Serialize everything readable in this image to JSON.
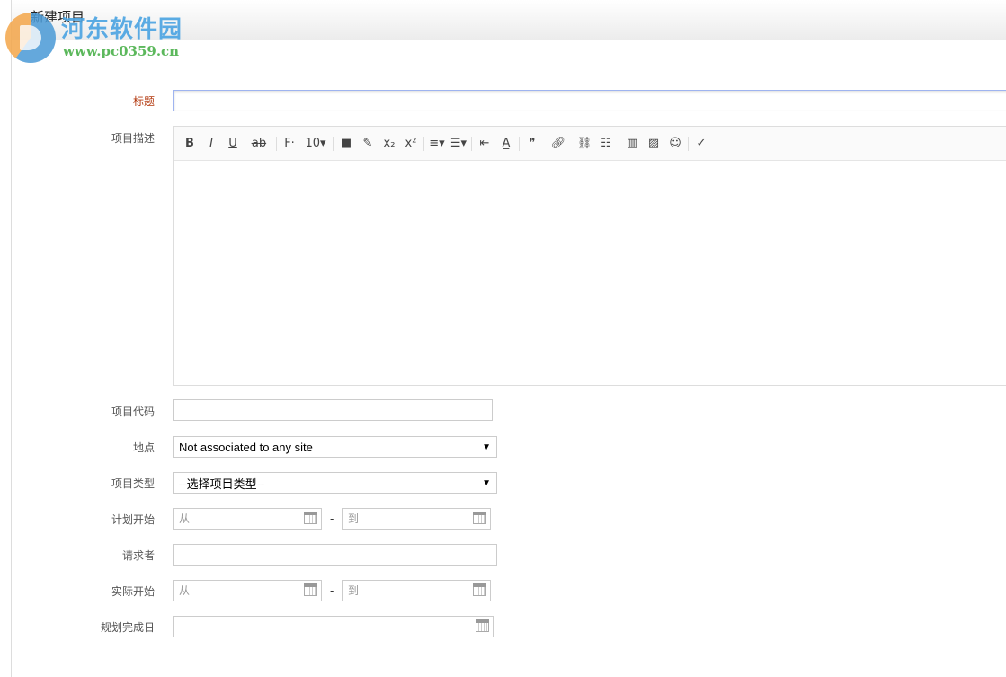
{
  "header": {
    "title": "新建项目"
  },
  "logo": {
    "name": "河东软件园",
    "url": "www.pc0359.cn"
  },
  "form": {
    "title": {
      "label": "标题",
      "value": ""
    },
    "description": {
      "label": "项目描述"
    },
    "code": {
      "label": "项目代码",
      "value": ""
    },
    "site": {
      "label": "地点",
      "selected": "Not associated to any site"
    },
    "type": {
      "label": "项目类型",
      "selected": "--选择项目类型--"
    },
    "planned_start": {
      "label": "计划开始",
      "from_placeholder": "从",
      "to_placeholder": "到",
      "separator": "-"
    },
    "requester": {
      "label": "请求者",
      "value": ""
    },
    "actual_start": {
      "label": "实际开始",
      "from_placeholder": "从",
      "to_placeholder": "到",
      "separator": "-"
    },
    "planned_end": {
      "label": "规划完成日",
      "value": ""
    }
  },
  "toolbar": {
    "items": [
      {
        "icon": "bold-icon",
        "glyph": "B"
      },
      {
        "icon": "italic-icon",
        "glyph": "I"
      },
      {
        "icon": "underline-icon",
        "glyph": "U"
      },
      {
        "icon": "strikethrough-icon",
        "glyph": "a̶b̶"
      },
      {
        "icon": "font-family-icon",
        "glyph": "F·"
      },
      {
        "icon": "font-size-icon",
        "glyph": "10▾"
      },
      {
        "icon": "text-color-icon",
        "glyph": "■"
      },
      {
        "icon": "highlight-icon",
        "glyph": "✎"
      },
      {
        "icon": "subscript-icon",
        "glyph": "x₂"
      },
      {
        "icon": "superscript-icon",
        "glyph": "x²"
      },
      {
        "icon": "align-icon",
        "glyph": "≡▾"
      },
      {
        "icon": "list-icon",
        "glyph": "☰▾"
      },
      {
        "icon": "outdent-icon",
        "glyph": "⇤"
      },
      {
        "icon": "clear-format-icon",
        "glyph": "A̲"
      },
      {
        "icon": "quote-icon",
        "glyph": "❞"
      },
      {
        "icon": "link-icon",
        "glyph": "🔗︎"
      },
      {
        "icon": "unlink-icon",
        "glyph": "⛓︎"
      },
      {
        "icon": "horizontal-rule-icon",
        "glyph": "☷"
      },
      {
        "icon": "table-icon",
        "glyph": "▥"
      },
      {
        "icon": "image-icon",
        "glyph": "▨"
      },
      {
        "icon": "emoji-icon",
        "glyph": "☺"
      },
      {
        "icon": "spellcheck-icon",
        "glyph": "✓"
      }
    ]
  }
}
